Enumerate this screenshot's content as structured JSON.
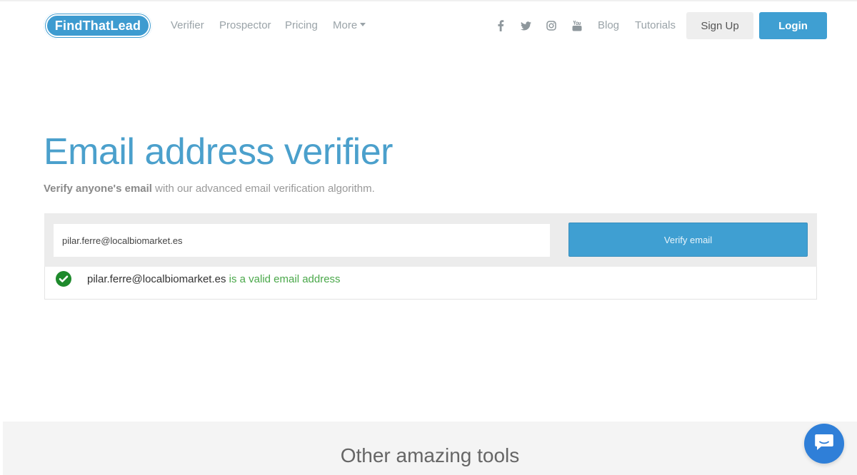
{
  "nav": {
    "logo": "FindThatLead",
    "links": [
      "Verifier",
      "Prospector",
      "Pricing",
      "More"
    ],
    "blog": "Blog",
    "tutorials": "Tutorials",
    "signup": "Sign Up",
    "login": "Login",
    "social_icons": [
      "facebook-icon",
      "twitter-icon",
      "instagram-icon",
      "youtube-icon"
    ]
  },
  "hero": {
    "title": "Email address verifier",
    "subtitle_bold": "Verify anyone's email",
    "subtitle_rest": " with our advanced email verification algorithm."
  },
  "verifier": {
    "input_value": "pilar.ferre@localbiomarket.es",
    "button_label": "Verify email"
  },
  "result": {
    "email": "pilar.ferre@localbiomarket.es",
    "status": " is a valid email address"
  },
  "tools": {
    "title": "Other amazing tools"
  },
  "colors": {
    "brand": "#3f9fd2",
    "success": "#4aa84a",
    "check": "#1e8a2c"
  }
}
